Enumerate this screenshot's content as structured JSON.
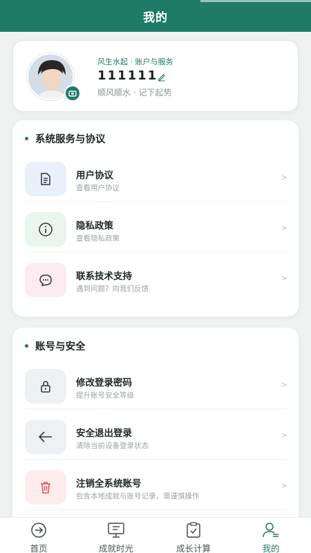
{
  "header": {
    "title": "我的"
  },
  "profile": {
    "tag": "风生水起 · 账户与服务",
    "name": "111111",
    "motto": "顺风顺水 · 记下起势"
  },
  "sections": [
    {
      "title": "系统服务与协议",
      "items": [
        {
          "title": "用户协议",
          "subtitle": "查看用户协议",
          "chevron": ">",
          "icon": "document-icon"
        },
        {
          "title": "隐私政策",
          "subtitle": "查看隐私政策",
          "chevron": ">",
          "icon": "info-icon"
        },
        {
          "title": "联系技术支持",
          "subtitle": "遇到问题？向我们反馈",
          "chevron": ">",
          "icon": "chat-icon"
        }
      ]
    },
    {
      "title": "账号与安全",
      "items": [
        {
          "title": "修改登录密码",
          "subtitle": "提升账号安全等级",
          "chevron": ">",
          "icon": "lock-icon"
        },
        {
          "title": "安全退出登录",
          "subtitle": "清除当前设备登录状态",
          "chevron": ">",
          "icon": "arrow-left-icon"
        },
        {
          "title": "注销全系统账号",
          "subtitle": "包含本地成就与账号记录，需谨慎操作",
          "chevron": ">",
          "icon": "trash-icon"
        }
      ]
    }
  ],
  "tabbar": {
    "tabs": [
      {
        "label": "首页",
        "icon": "arrow-circle-icon"
      },
      {
        "label": "成就时光",
        "icon": "monitor-icon"
      },
      {
        "label": "成长计算",
        "icon": "clipboard-check-icon"
      },
      {
        "label": "我的",
        "icon": "user-icon",
        "active": true
      }
    ]
  },
  "colors": {
    "brand": "#1f7a68",
    "background": "#eef3f1",
    "danger": "#d9534f"
  }
}
